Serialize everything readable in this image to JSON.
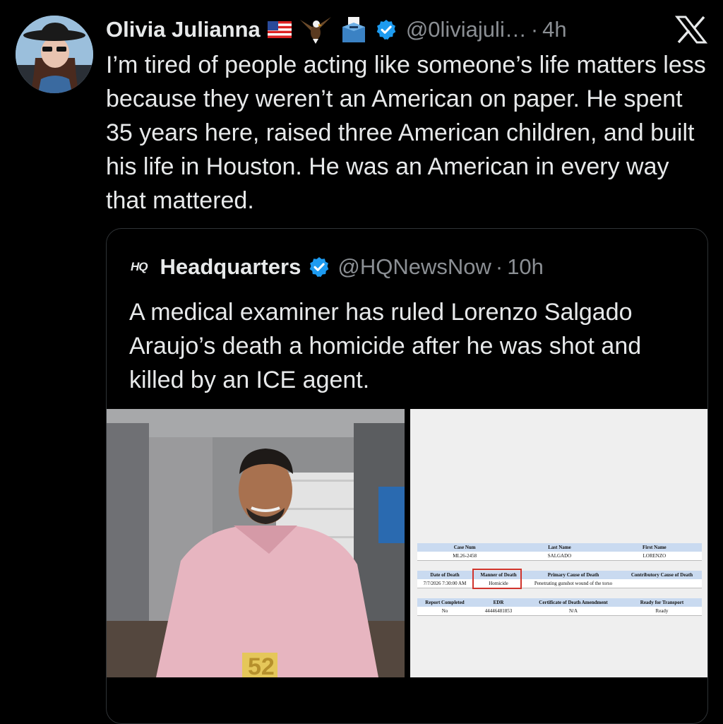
{
  "tweet": {
    "author_name": "Olivia Julianna",
    "author_emojis": [
      "us-flag",
      "eagle",
      "ballot-box"
    ],
    "handle": "@0liviajuli…",
    "separator": "·",
    "time": "4h",
    "text": "I’m tired of people acting like someone’s life matters less because they weren’t an American on paper. He spent 35 years here, raised three American children, and built his life in Houston. He was an American in every way that mattered."
  },
  "quote": {
    "logo_text": "HQ",
    "author_name": "Headquarters",
    "handle": "@HQNewsNow",
    "separator": "·",
    "time": "10h",
    "text": "A medical examiner has ruled Lorenzo Salgado Araujo’s death a homicide after he was shot and killed by an ICE agent.",
    "photo_cake_number": "52"
  },
  "document": {
    "section1": {
      "headers": [
        "Case Num",
        "Last Name",
        "First Name"
      ],
      "values": [
        "ML26-2458",
        "SALGADO",
        "LORENZO"
      ]
    },
    "section2": {
      "headers": [
        "Date of Death",
        "Manner of Death",
        "Primary Cause of Death",
        "Contributory Cause of Death"
      ],
      "values": [
        "7/7/2026 7:30:00 AM",
        "Homicide",
        "Penetrating gunshot wound of the torso",
        ""
      ]
    },
    "section3": {
      "headers": [
        "Report Completed",
        "EDR",
        "Certificate of Death Amendment",
        "Ready for Transport"
      ],
      "values": [
        "No",
        "44446481853",
        "N/A",
        "Ready"
      ]
    }
  },
  "colors": {
    "background": "#000000",
    "text": "#e7e9ea",
    "muted": "#8b8f94",
    "verified": "#1d9bf0",
    "border": "#2f3336",
    "highlight_box": "#d0342c"
  },
  "icons": [
    "x-logo-icon",
    "verified-badge-icon",
    "us-flag-icon",
    "eagle-icon",
    "ballot-box-icon"
  ]
}
